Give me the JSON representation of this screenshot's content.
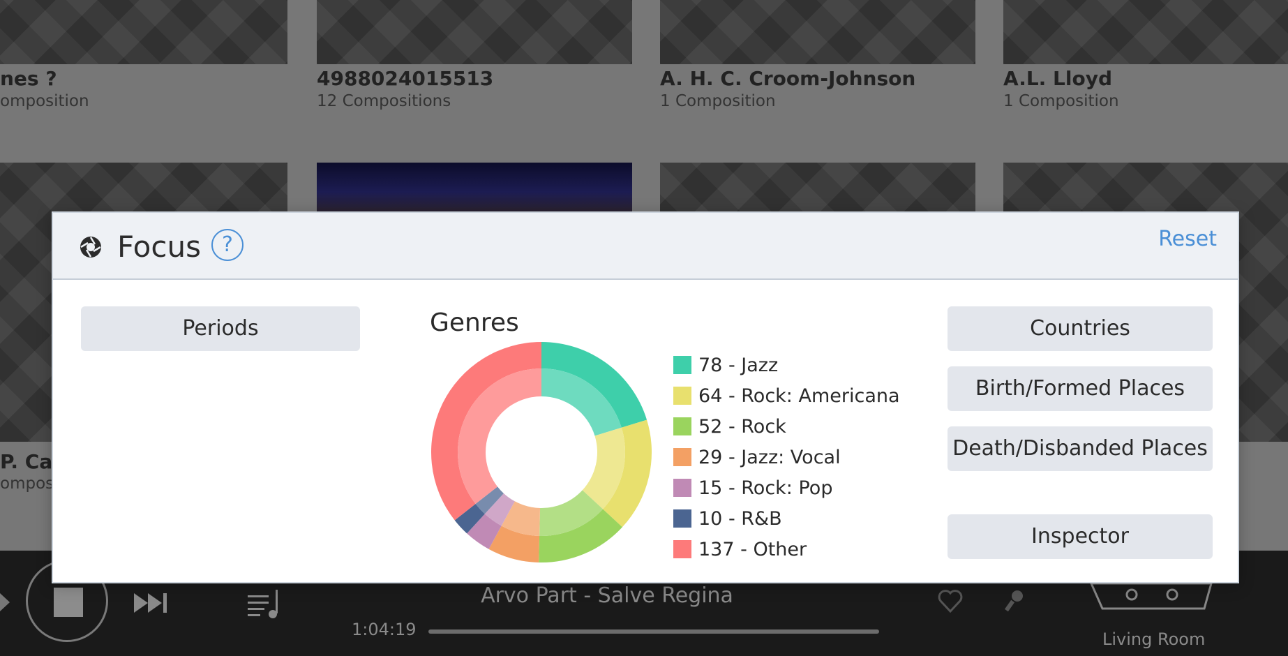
{
  "background": {
    "artists": [
      {
        "name": "nes ?",
        "count": "omposition"
      },
      {
        "name": "4988024015513",
        "count": "12 Compositions"
      },
      {
        "name": "A. H. C. Croom-Johnson",
        "count": "1 Composition"
      },
      {
        "name": "A.L. Lloyd",
        "count": "1 Composition"
      },
      {
        "name": "P. Cart",
        "count": "ompos"
      }
    ]
  },
  "player": {
    "now_playing": "Arvo Part - Salve Regina",
    "elapsed": "1:04:19",
    "zone": "Living Room",
    "icons": [
      "previous-icon",
      "stop-icon",
      "next-icon",
      "queue-icon",
      "heart-icon",
      "mic-icon",
      "device-icon"
    ]
  },
  "dialog": {
    "title": "Focus",
    "help_label": "?",
    "reset_label": "Reset",
    "left_buttons": [
      "Periods"
    ],
    "right_buttons": [
      "Countries",
      "Birth/Formed Places",
      "Death/Disbanded Places",
      "Inspector"
    ],
    "genres_heading": "Genres"
  },
  "chart_data": {
    "type": "pie",
    "title": "Genres",
    "donut": true,
    "series": [
      {
        "label": "78 - Jazz",
        "value": 78,
        "color": "#3ecfaa"
      },
      {
        "label": "64 - Rock: Americana",
        "value": 64,
        "color": "#e8e06e"
      },
      {
        "label": "52 - Rock",
        "value": 52,
        "color": "#9ad45e"
      },
      {
        "label": "29 - Jazz: Vocal",
        "value": 29,
        "color": "#f3a064"
      },
      {
        "label": "15 - Rock: Pop",
        "value": 15,
        "color": "#c08ab5"
      },
      {
        "label": "10 - R&B",
        "value": 10,
        "color": "#4b6591"
      },
      {
        "label": "137 - Other",
        "value": 137,
        "color": "#fd7a7a"
      }
    ]
  }
}
